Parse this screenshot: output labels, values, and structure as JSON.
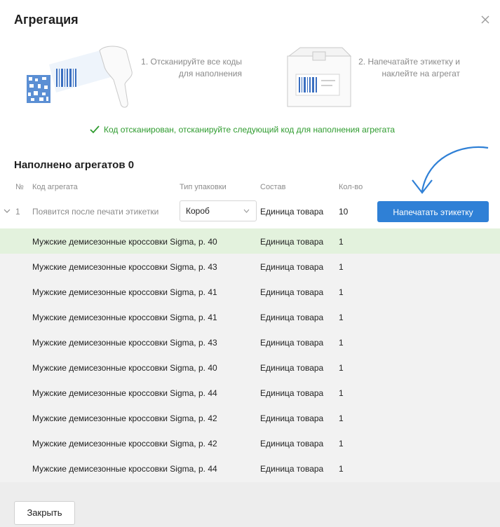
{
  "dialog": {
    "title": "Агрегация",
    "steps": [
      {
        "text": "1. Отсканируйте все коды для наполнения"
      },
      {
        "text": "2. Напечатайте этикетку и наклейте на агрегат"
      }
    ],
    "status_text": "Код отсканирован, отсканируйте следующий код для наполнения агрегата",
    "section_title": "Наполнено агрегатов 0"
  },
  "colors": {
    "accent": "#2f80d6",
    "success": "#2e9b2e",
    "highlight_row": "#e3f2dd",
    "arrow": "#2f80d6"
  },
  "icons": [
    "close-icon",
    "barcode-scanner-icon",
    "box-label-icon",
    "check-icon",
    "chevron-down-icon",
    "curved-arrow-icon"
  ],
  "table": {
    "columns": [
      "№",
      "Код агрегата",
      "Тип упаковки",
      "Состав",
      "Кол-во"
    ],
    "aggregate": {
      "num": "1",
      "code": "Появится после печати этикетки",
      "pack_type": "Короб",
      "composition": "Единица товара",
      "qty": "10",
      "print_label": "Напечатать этикетку"
    },
    "items": [
      {
        "name": "Мужские демисезонные кроссовки Sigma, р. 40",
        "comp": "Единица товара",
        "qty": "1"
      },
      {
        "name": "Мужские демисезонные кроссовки Sigma, р. 43",
        "comp": "Единица товара",
        "qty": "1"
      },
      {
        "name": "Мужские демисезонные кроссовки Sigma, р. 41",
        "comp": "Единица товара",
        "qty": "1"
      },
      {
        "name": "Мужские демисезонные кроссовки Sigma, р. 41",
        "comp": "Единица товара",
        "qty": "1"
      },
      {
        "name": "Мужские демисезонные кроссовки Sigma, р. 43",
        "comp": "Единица товара",
        "qty": "1"
      },
      {
        "name": "Мужские демисезонные кроссовки Sigma, р. 40",
        "comp": "Единица товара",
        "qty": "1"
      },
      {
        "name": "Мужские демисезонные кроссовки Sigma, р. 44",
        "comp": "Единица товара",
        "qty": "1"
      },
      {
        "name": "Мужские демисезонные кроссовки Sigma, р. 42",
        "comp": "Единица товара",
        "qty": "1"
      },
      {
        "name": "Мужские демисезонные кроссовки Sigma, р. 42",
        "comp": "Единица товара",
        "qty": "1"
      },
      {
        "name": "Мужские демисезонные кроссовки Sigma, р. 44",
        "comp": "Единица товара",
        "qty": "1"
      }
    ]
  },
  "footer": {
    "close_label": "Закрыть"
  }
}
